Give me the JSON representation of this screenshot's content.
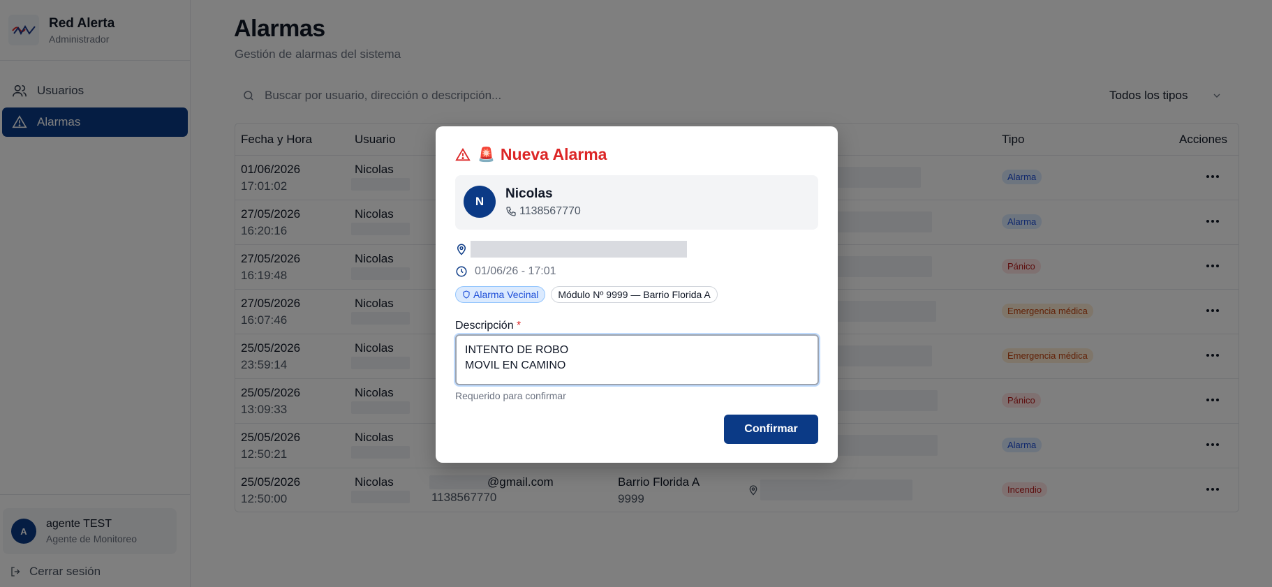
{
  "brand": {
    "name": "Red Alerta",
    "role": "Administrador"
  },
  "nav": {
    "items": [
      {
        "label": "Usuarios"
      },
      {
        "label": "Alarmas"
      }
    ]
  },
  "current_user": {
    "initial": "A",
    "name": "agente TEST",
    "role": "Agente de Monitoreo"
  },
  "logout_label": "Cerrar sesión",
  "page": {
    "title": "Alarmas",
    "subtitle": "Gestión de alarmas del sistema"
  },
  "search": {
    "placeholder": "Buscar por usuario, dirección o descripción..."
  },
  "type_filter": {
    "selected": "Todos los tipos"
  },
  "table": {
    "headers": {
      "datetime": "Fecha y Hora",
      "user": "Usuario",
      "type": "Tipo",
      "actions": "Acciones"
    },
    "rows": [
      {
        "date": "01/06/2026",
        "time": "17:01:02",
        "user": "Nicolas",
        "type": "Alarma"
      },
      {
        "date": "27/05/2026",
        "time": "16:20:16",
        "user": "Nicolas",
        "type": "Alarma"
      },
      {
        "date": "27/05/2026",
        "time": "16:19:48",
        "user": "Nicolas",
        "type": "Pánico"
      },
      {
        "date": "27/05/2026",
        "time": "16:07:46",
        "user": "Nicolas",
        "type": "Emergencia médica"
      },
      {
        "date": "25/05/2026",
        "time": "23:59:14",
        "user": "Nicolas",
        "type": "Emergencia médica"
      },
      {
        "date": "25/05/2026",
        "time": "13:09:33",
        "user": "Nicolas",
        "type": "Pánico"
      },
      {
        "date": "25/05/2026",
        "time": "12:50:21",
        "user": "Nicolas",
        "type": "Alarma"
      },
      {
        "date": "25/05/2026",
        "time": "12:50:00",
        "user": "Nicolas",
        "type": "Incendio",
        "email_suffix": "@gmail.com",
        "phone": "1138567770",
        "neighborhood": "Barrio Florida A",
        "module": "9999"
      }
    ]
  },
  "modal": {
    "title": "Nueva Alarma",
    "siren_icon": "🚨",
    "caller": {
      "initial": "N",
      "name": "Nicolas",
      "phone": "1138567770"
    },
    "timestamp": "01/06/26 - 17:01",
    "chip_type": "Alarma Vecinal",
    "chip_module": "Módulo Nº 9999 — Barrio Florida A",
    "description_label": "Descripción",
    "required_mark": "*",
    "description_value": "INTENTO DE ROBO\nMOVIL EN CAMINO",
    "hint": "Requerido para confirmar",
    "confirm_label": "Confirmar"
  },
  "colors": {
    "primary": "#0b3a86",
    "danger": "#dc2626",
    "badge_alarma": "#dbeafe",
    "badge_panico": "#fee2e2",
    "badge_medica": "#ffedd5"
  }
}
